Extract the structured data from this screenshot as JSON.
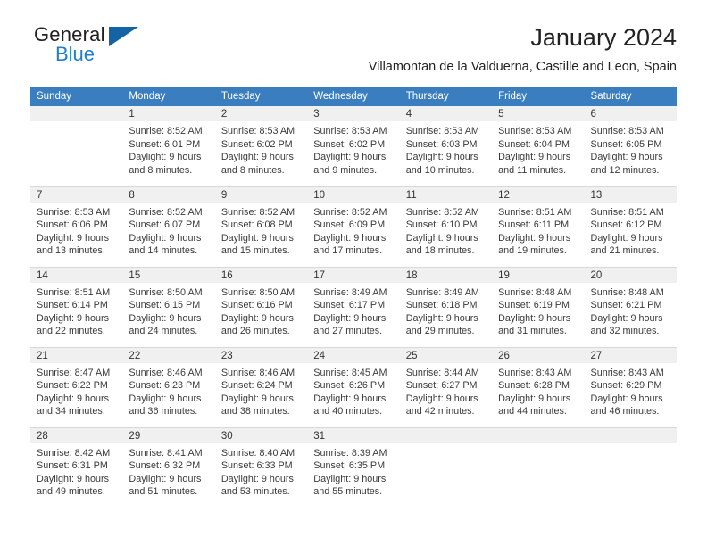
{
  "brand": {
    "name_top": "General",
    "name_bottom": "Blue",
    "accent_color": "#1464a5",
    "text_color": "#231f20"
  },
  "header": {
    "title": "January 2024",
    "subtitle": "Villamontan de la Valduerna, Castille and Leon, Spain"
  },
  "calendar": {
    "header_bg": "#3a7ebf",
    "header_text": "#ffffff",
    "daynum_bg": "#f0f0f0",
    "weekday_headers": [
      "Sunday",
      "Monday",
      "Tuesday",
      "Wednesday",
      "Thursday",
      "Friday",
      "Saturday"
    ],
    "weeks": [
      [
        {
          "day": "",
          "sunrise": "",
          "sunset": "",
          "daylight_line1": "",
          "daylight_line2": ""
        },
        {
          "day": "1",
          "sunrise": "Sunrise: 8:52 AM",
          "sunset": "Sunset: 6:01 PM",
          "daylight_line1": "Daylight: 9 hours",
          "daylight_line2": "and 8 minutes."
        },
        {
          "day": "2",
          "sunrise": "Sunrise: 8:53 AM",
          "sunset": "Sunset: 6:02 PM",
          "daylight_line1": "Daylight: 9 hours",
          "daylight_line2": "and 8 minutes."
        },
        {
          "day": "3",
          "sunrise": "Sunrise: 8:53 AM",
          "sunset": "Sunset: 6:02 PM",
          "daylight_line1": "Daylight: 9 hours",
          "daylight_line2": "and 9 minutes."
        },
        {
          "day": "4",
          "sunrise": "Sunrise: 8:53 AM",
          "sunset": "Sunset: 6:03 PM",
          "daylight_line1": "Daylight: 9 hours",
          "daylight_line2": "and 10 minutes."
        },
        {
          "day": "5",
          "sunrise": "Sunrise: 8:53 AM",
          "sunset": "Sunset: 6:04 PM",
          "daylight_line1": "Daylight: 9 hours",
          "daylight_line2": "and 11 minutes."
        },
        {
          "day": "6",
          "sunrise": "Sunrise: 8:53 AM",
          "sunset": "Sunset: 6:05 PM",
          "daylight_line1": "Daylight: 9 hours",
          "daylight_line2": "and 12 minutes."
        }
      ],
      [
        {
          "day": "7",
          "sunrise": "Sunrise: 8:53 AM",
          "sunset": "Sunset: 6:06 PM",
          "daylight_line1": "Daylight: 9 hours",
          "daylight_line2": "and 13 minutes."
        },
        {
          "day": "8",
          "sunrise": "Sunrise: 8:52 AM",
          "sunset": "Sunset: 6:07 PM",
          "daylight_line1": "Daylight: 9 hours",
          "daylight_line2": "and 14 minutes."
        },
        {
          "day": "9",
          "sunrise": "Sunrise: 8:52 AM",
          "sunset": "Sunset: 6:08 PM",
          "daylight_line1": "Daylight: 9 hours",
          "daylight_line2": "and 15 minutes."
        },
        {
          "day": "10",
          "sunrise": "Sunrise: 8:52 AM",
          "sunset": "Sunset: 6:09 PM",
          "daylight_line1": "Daylight: 9 hours",
          "daylight_line2": "and 17 minutes."
        },
        {
          "day": "11",
          "sunrise": "Sunrise: 8:52 AM",
          "sunset": "Sunset: 6:10 PM",
          "daylight_line1": "Daylight: 9 hours",
          "daylight_line2": "and 18 minutes."
        },
        {
          "day": "12",
          "sunrise": "Sunrise: 8:51 AM",
          "sunset": "Sunset: 6:11 PM",
          "daylight_line1": "Daylight: 9 hours",
          "daylight_line2": "and 19 minutes."
        },
        {
          "day": "13",
          "sunrise": "Sunrise: 8:51 AM",
          "sunset": "Sunset: 6:12 PM",
          "daylight_line1": "Daylight: 9 hours",
          "daylight_line2": "and 21 minutes."
        }
      ],
      [
        {
          "day": "14",
          "sunrise": "Sunrise: 8:51 AM",
          "sunset": "Sunset: 6:14 PM",
          "daylight_line1": "Daylight: 9 hours",
          "daylight_line2": "and 22 minutes."
        },
        {
          "day": "15",
          "sunrise": "Sunrise: 8:50 AM",
          "sunset": "Sunset: 6:15 PM",
          "daylight_line1": "Daylight: 9 hours",
          "daylight_line2": "and 24 minutes."
        },
        {
          "day": "16",
          "sunrise": "Sunrise: 8:50 AM",
          "sunset": "Sunset: 6:16 PM",
          "daylight_line1": "Daylight: 9 hours",
          "daylight_line2": "and 26 minutes."
        },
        {
          "day": "17",
          "sunrise": "Sunrise: 8:49 AM",
          "sunset": "Sunset: 6:17 PM",
          "daylight_line1": "Daylight: 9 hours",
          "daylight_line2": "and 27 minutes."
        },
        {
          "day": "18",
          "sunrise": "Sunrise: 8:49 AM",
          "sunset": "Sunset: 6:18 PM",
          "daylight_line1": "Daylight: 9 hours",
          "daylight_line2": "and 29 minutes."
        },
        {
          "day": "19",
          "sunrise": "Sunrise: 8:48 AM",
          "sunset": "Sunset: 6:19 PM",
          "daylight_line1": "Daylight: 9 hours",
          "daylight_line2": "and 31 minutes."
        },
        {
          "day": "20",
          "sunrise": "Sunrise: 8:48 AM",
          "sunset": "Sunset: 6:21 PM",
          "daylight_line1": "Daylight: 9 hours",
          "daylight_line2": "and 32 minutes."
        }
      ],
      [
        {
          "day": "21",
          "sunrise": "Sunrise: 8:47 AM",
          "sunset": "Sunset: 6:22 PM",
          "daylight_line1": "Daylight: 9 hours",
          "daylight_line2": "and 34 minutes."
        },
        {
          "day": "22",
          "sunrise": "Sunrise: 8:46 AM",
          "sunset": "Sunset: 6:23 PM",
          "daylight_line1": "Daylight: 9 hours",
          "daylight_line2": "and 36 minutes."
        },
        {
          "day": "23",
          "sunrise": "Sunrise: 8:46 AM",
          "sunset": "Sunset: 6:24 PM",
          "daylight_line1": "Daylight: 9 hours",
          "daylight_line2": "and 38 minutes."
        },
        {
          "day": "24",
          "sunrise": "Sunrise: 8:45 AM",
          "sunset": "Sunset: 6:26 PM",
          "daylight_line1": "Daylight: 9 hours",
          "daylight_line2": "and 40 minutes."
        },
        {
          "day": "25",
          "sunrise": "Sunrise: 8:44 AM",
          "sunset": "Sunset: 6:27 PM",
          "daylight_line1": "Daylight: 9 hours",
          "daylight_line2": "and 42 minutes."
        },
        {
          "day": "26",
          "sunrise": "Sunrise: 8:43 AM",
          "sunset": "Sunset: 6:28 PM",
          "daylight_line1": "Daylight: 9 hours",
          "daylight_line2": "and 44 minutes."
        },
        {
          "day": "27",
          "sunrise": "Sunrise: 8:43 AM",
          "sunset": "Sunset: 6:29 PM",
          "daylight_line1": "Daylight: 9 hours",
          "daylight_line2": "and 46 minutes."
        }
      ],
      [
        {
          "day": "28",
          "sunrise": "Sunrise: 8:42 AM",
          "sunset": "Sunset: 6:31 PM",
          "daylight_line1": "Daylight: 9 hours",
          "daylight_line2": "and 49 minutes."
        },
        {
          "day": "29",
          "sunrise": "Sunrise: 8:41 AM",
          "sunset": "Sunset: 6:32 PM",
          "daylight_line1": "Daylight: 9 hours",
          "daylight_line2": "and 51 minutes."
        },
        {
          "day": "30",
          "sunrise": "Sunrise: 8:40 AM",
          "sunset": "Sunset: 6:33 PM",
          "daylight_line1": "Daylight: 9 hours",
          "daylight_line2": "and 53 minutes."
        },
        {
          "day": "31",
          "sunrise": "Sunrise: 8:39 AM",
          "sunset": "Sunset: 6:35 PM",
          "daylight_line1": "Daylight: 9 hours",
          "daylight_line2": "and 55 minutes."
        },
        {
          "day": "",
          "sunrise": "",
          "sunset": "",
          "daylight_line1": "",
          "daylight_line2": ""
        },
        {
          "day": "",
          "sunrise": "",
          "sunset": "",
          "daylight_line1": "",
          "daylight_line2": ""
        },
        {
          "day": "",
          "sunrise": "",
          "sunset": "",
          "daylight_line1": "",
          "daylight_line2": ""
        }
      ]
    ]
  }
}
